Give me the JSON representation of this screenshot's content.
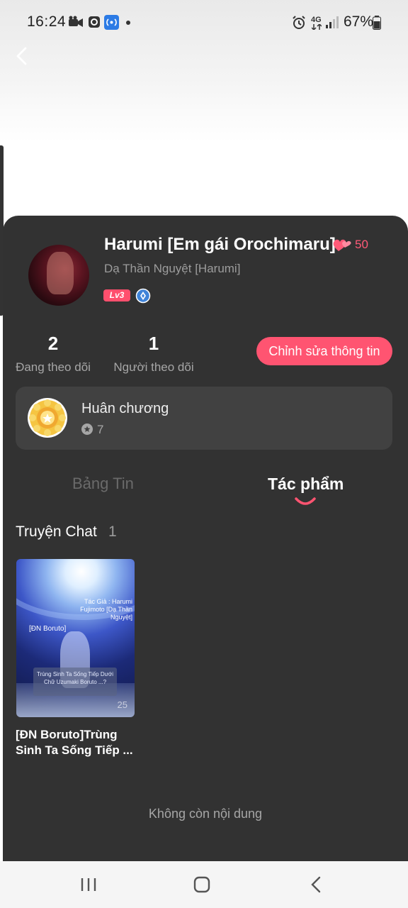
{
  "status_bar": {
    "time": "16:24",
    "network": "4G",
    "battery": "67%"
  },
  "profile": {
    "name": "Harumi [Em gái Orochimaru]",
    "hearts": "50",
    "handle": "Dạ Thần Nguyệt [Harumi]",
    "level": "Lv3"
  },
  "stats": {
    "following_count": "2",
    "following_label": "Đang theo dõi",
    "followers_count": "1",
    "followers_label": "Người theo dõi",
    "edit_button": "Chỉnh sửa thông tin"
  },
  "medals": {
    "title": "Huân chương",
    "count": "7"
  },
  "tabs": [
    {
      "label": "Bảng Tin",
      "active": false
    },
    {
      "label": "Tác phẩm",
      "active": true
    }
  ],
  "section": {
    "title": "Truyện Chat",
    "count": "1"
  },
  "story": {
    "title": "[ĐN Boruto]Trùng Sinh Ta Sống Tiếp ...",
    "cover_author": "Tác Giả : Harumi Fujimoto [Dạ Thần Nguyệt]",
    "cover_tag": "[ĐN Boruto]",
    "cover_box": "Trùng Sinh Ta Sống Tiếp Dưới Chữ Uzumaki Boruto ...?",
    "views": "25"
  },
  "end_message": "Không còn nội dung",
  "colors": {
    "accent": "#ff5471",
    "sheet": "#323232",
    "card": "#414141"
  }
}
